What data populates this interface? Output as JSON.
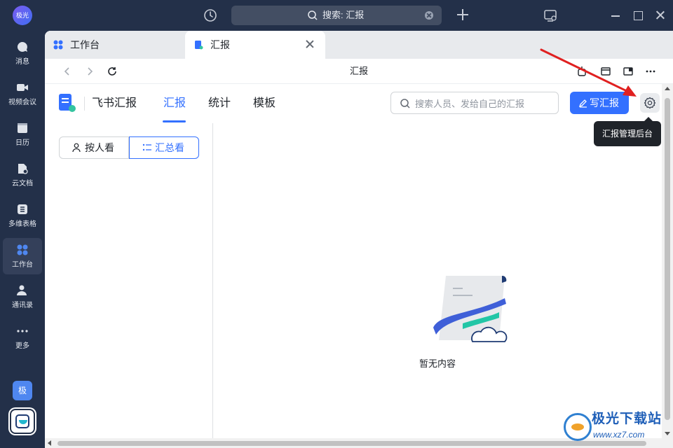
{
  "titlebar": {
    "avatar_text": "极光",
    "search_text": "搜索: 汇报"
  },
  "leftnav": {
    "items": [
      {
        "label": "消息"
      },
      {
        "label": "视频会议"
      },
      {
        "label": "日历",
        "icon_text": "13"
      },
      {
        "label": "云文档"
      },
      {
        "label": "多维表格"
      },
      {
        "label": "工作台"
      },
      {
        "label": "通讯录"
      },
      {
        "label": "更多"
      }
    ],
    "badge_text": "极"
  },
  "tabs": [
    {
      "label": "工作台"
    },
    {
      "label": "汇报"
    }
  ],
  "addressbar": {
    "title": "汇报"
  },
  "app": {
    "name": "飞书汇报",
    "tabs": [
      {
        "label": "汇报",
        "active": true
      },
      {
        "label": "统计"
      },
      {
        "label": "模板"
      }
    ],
    "search_placeholder": "搜索人员、发给自己的汇报",
    "write_button": "写汇报",
    "settings_tooltip": "汇报管理后台"
  },
  "view_toggle": {
    "by_person": "按人看",
    "summary": "汇总看",
    "selected": "汇总看"
  },
  "empty_state": {
    "text": "暂无内容"
  },
  "watermark": {
    "title": "极光下载站",
    "url": "www.xz7.com"
  },
  "colors": {
    "accent": "#3370ff",
    "sidebar_bg": "#233049",
    "annotation_arrow": "#e02020"
  }
}
